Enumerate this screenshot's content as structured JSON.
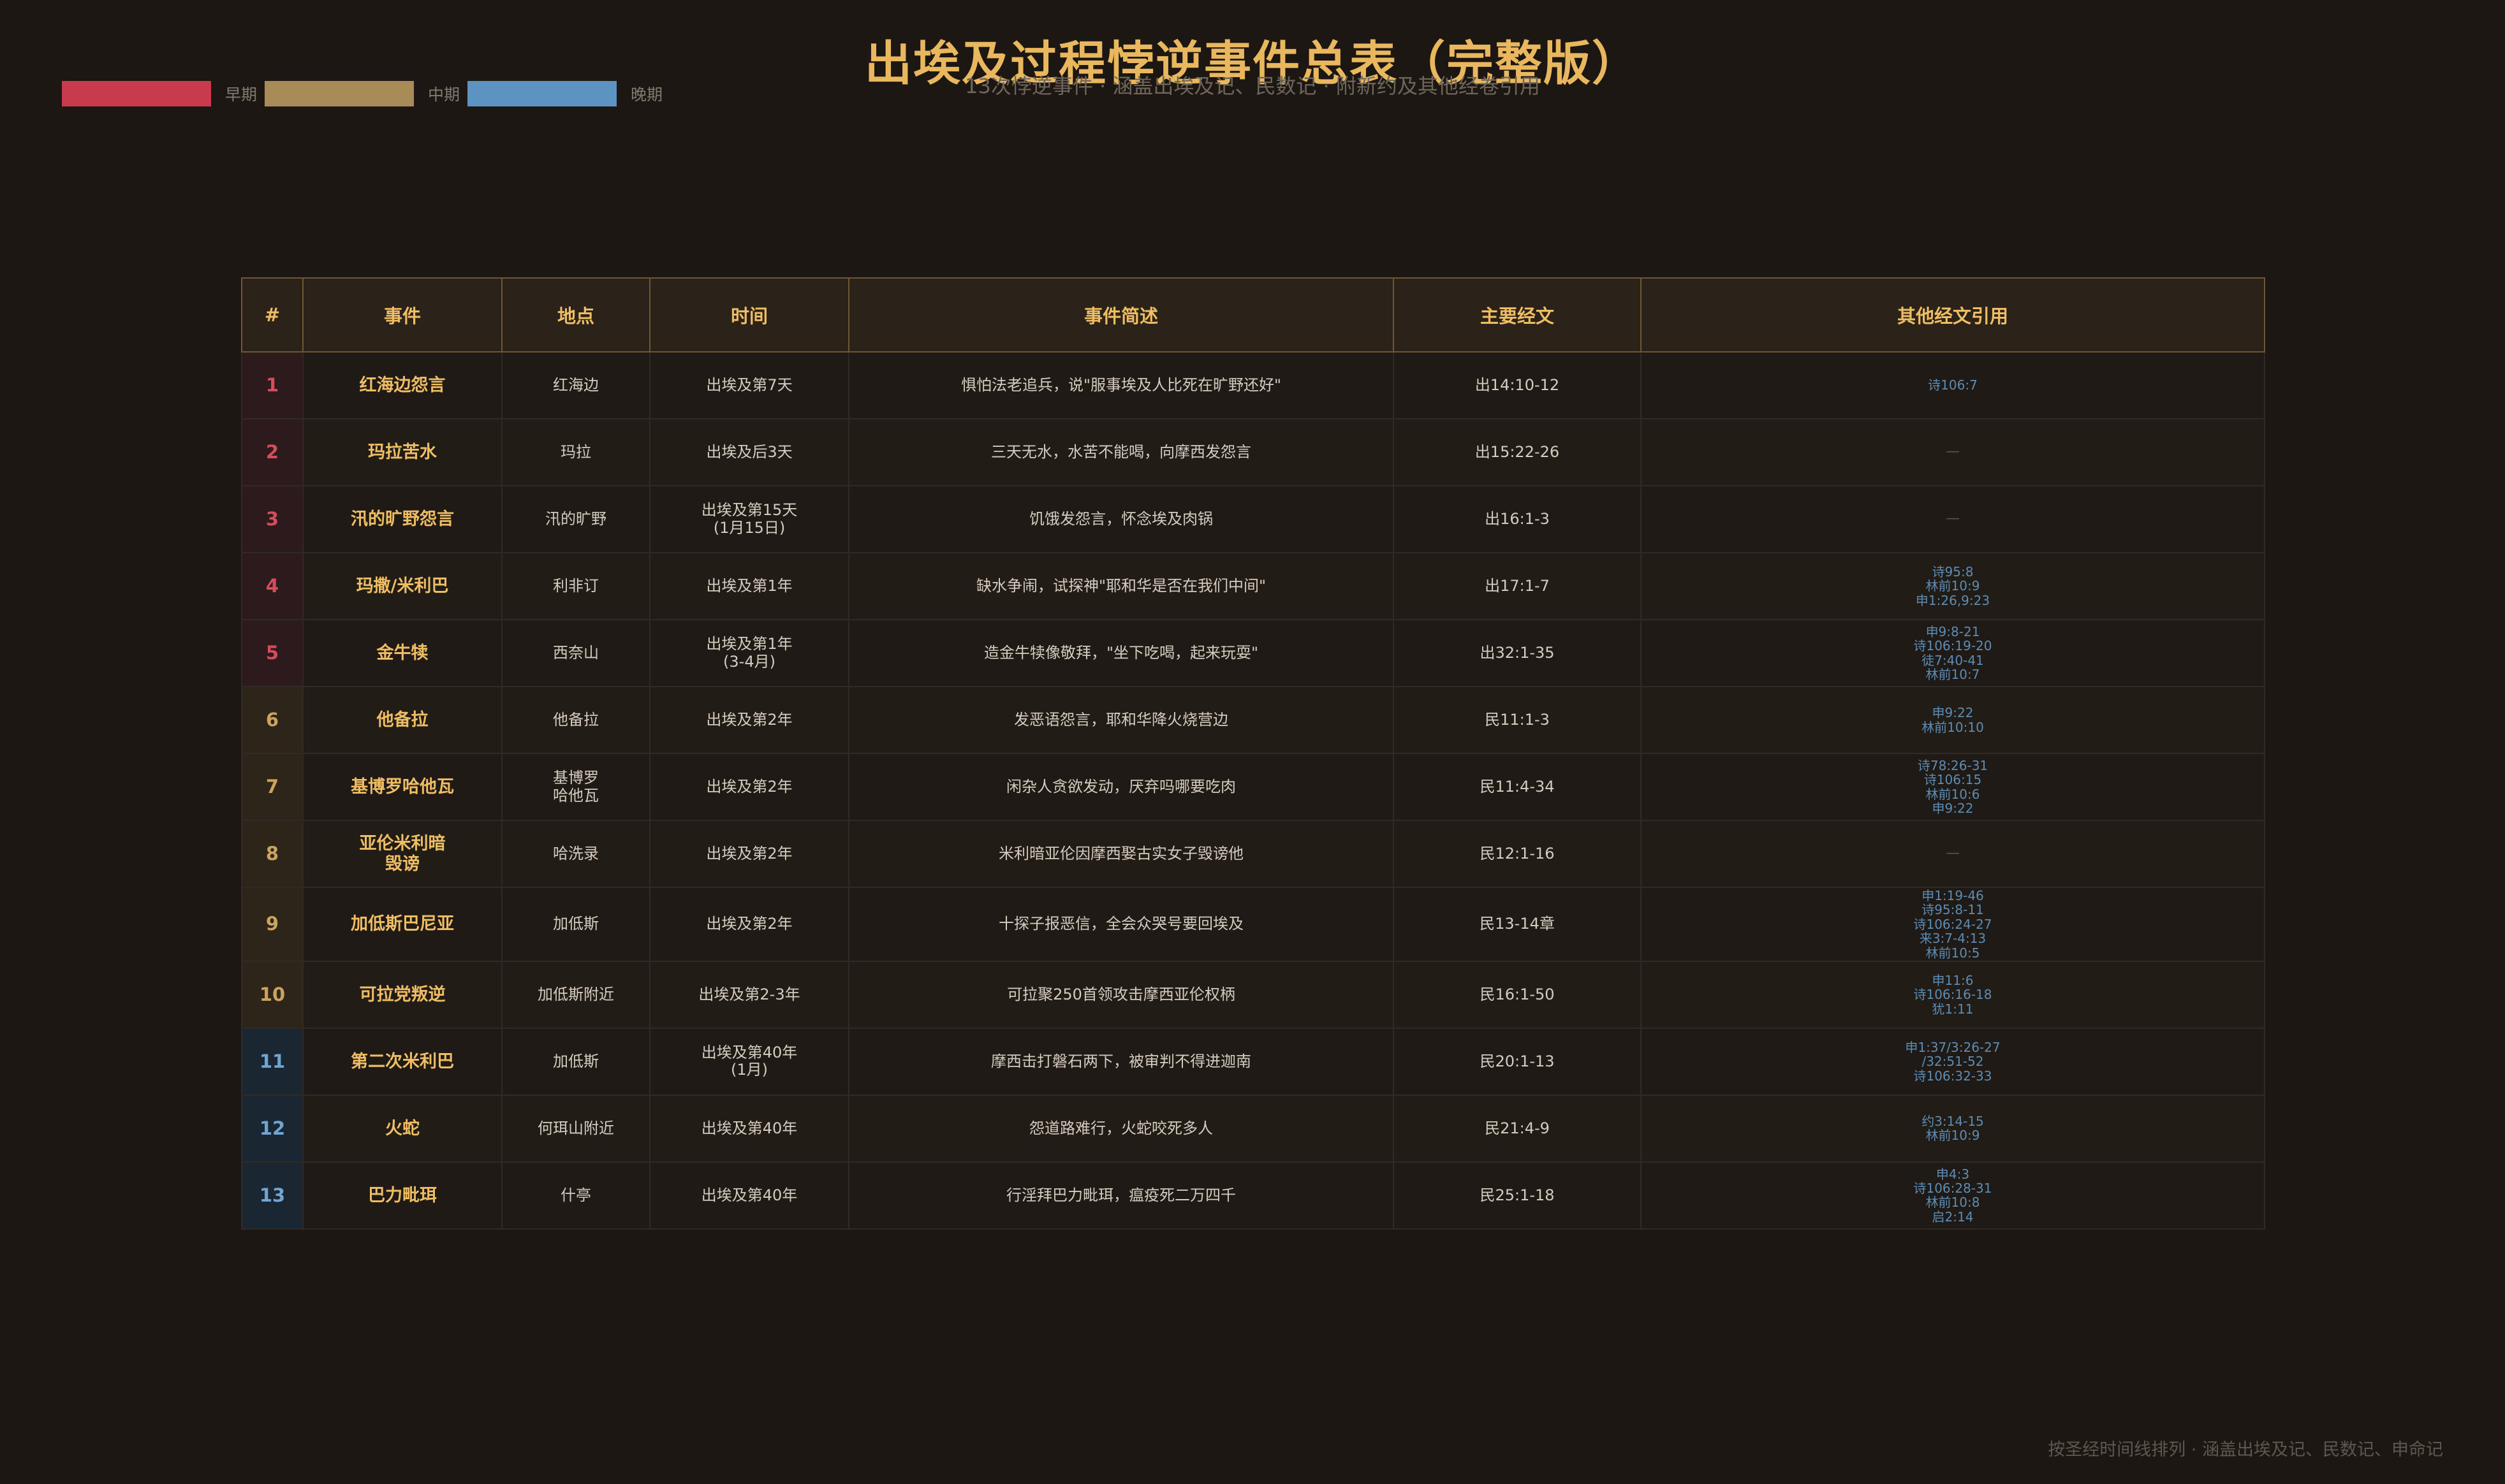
{
  "title": "出埃及过程悖逆事件总表（完整版）",
  "subtitle": "13次悖逆事件 · 涵盖出埃及记、民数记 · 附新约及其他经卷引用",
  "legend": [
    {
      "label": "早期",
      "color": "#c83a4c"
    },
    {
      "label": "中期",
      "color": "#a88c57"
    },
    {
      "label": "晚期",
      "color": "#5d93c0"
    }
  ],
  "colors": {
    "early": "#d44d5c",
    "mid": "#c9a35f",
    "late": "#6fa5d0",
    "accent": "#efbe64"
  },
  "table": {
    "headers": [
      "#",
      "事件",
      "地点",
      "时间",
      "事件简述",
      "主要经文",
      "其他经文引用"
    ],
    "rows": [
      {
        "num": "1",
        "period": "early",
        "event": "红海边怨言",
        "place": "红海边",
        "time": "出埃及第7天",
        "summary": "惧怕法老追兵，说\"服事埃及人比死在旷野还好\"",
        "main": "出14:10-12",
        "refs": [
          "诗106:7"
        ]
      },
      {
        "num": "2",
        "period": "early",
        "event": "玛拉苦水",
        "place": "玛拉",
        "time": "出埃及后3天",
        "summary": "三天无水，水苦不能喝，向摩西发怨言",
        "main": "出15:22-26",
        "refs": [
          "—"
        ]
      },
      {
        "num": "3",
        "period": "early",
        "event": "汛的旷野怨言",
        "place": "汛的旷野",
        "time": "出埃及第15天\n(1月15日)",
        "summary": "饥饿发怨言，怀念埃及肉锅",
        "main": "出16:1-3",
        "refs": [
          "—"
        ]
      },
      {
        "num": "4",
        "period": "early",
        "event": "玛撒/米利巴",
        "place": "利非订",
        "time": "出埃及第1年",
        "summary": "缺水争闹，试探神\"耶和华是否在我们中间\"",
        "main": "出17:1-7",
        "refs": [
          "诗95:8",
          "林前10:9",
          "申1:26,9:23"
        ]
      },
      {
        "num": "5",
        "period": "early",
        "event": "金牛犊",
        "place": "西奈山",
        "time": "出埃及第1年\n(3-4月)",
        "summary": "造金牛犊像敬拜，\"坐下吃喝，起来玩耍\"",
        "main": "出32:1-35",
        "refs": [
          "申9:8-21",
          "诗106:19-20",
          "徒7:40-41",
          "林前10:7"
        ]
      },
      {
        "num": "6",
        "period": "mid",
        "event": "他备拉",
        "place": "他备拉",
        "time": "出埃及第2年",
        "summary": "发恶语怨言，耶和华降火烧营边",
        "main": "民11:1-3",
        "refs": [
          "申9:22",
          "林前10:10"
        ]
      },
      {
        "num": "7",
        "period": "mid",
        "event": "基博罗哈他瓦",
        "place": "基博罗\n哈他瓦",
        "time": "出埃及第2年",
        "summary": "闲杂人贪欲发动，厌弃吗哪要吃肉",
        "main": "民11:4-34",
        "refs": [
          "诗78:26-31",
          "诗106:15",
          "林前10:6",
          "申9:22"
        ]
      },
      {
        "num": "8",
        "period": "mid",
        "event": "亚伦米利暗\n毁谤",
        "place": "哈洗录",
        "time": "出埃及第2年",
        "summary": "米利暗亚伦因摩西娶古实女子毁谤他",
        "main": "民12:1-16",
        "refs": [
          "—"
        ]
      },
      {
        "num": "9",
        "period": "mid",
        "event": "加低斯巴尼亚",
        "place": "加低斯",
        "time": "出埃及第2年",
        "summary": "十探子报恶信，全会众哭号要回埃及",
        "main": "民13-14章",
        "refs": [
          "申1:19-46",
          "诗95:8-11",
          "诗106:24-27",
          "来3:7-4:13",
          "林前10:5"
        ]
      },
      {
        "num": "10",
        "period": "mid",
        "event": "可拉党叛逆",
        "place": "加低斯附近",
        "time": "出埃及第2-3年",
        "summary": "可拉聚250首领攻击摩西亚伦权柄",
        "main": "民16:1-50",
        "refs": [
          "申11:6",
          "诗106:16-18",
          "犹1:11"
        ]
      },
      {
        "num": "11",
        "period": "late",
        "event": "第二次米利巴",
        "place": "加低斯",
        "time": "出埃及第40年\n(1月)",
        "summary": "摩西击打磐石两下，被审判不得进迦南",
        "main": "民20:1-13",
        "refs": [
          "申1:37/3:26-27",
          "/32:51-52",
          "诗106:32-33"
        ]
      },
      {
        "num": "12",
        "period": "late",
        "event": "火蛇",
        "place": "何珥山附近",
        "time": "出埃及第40年",
        "summary": "怨道路难行，火蛇咬死多人",
        "main": "民21:4-9",
        "refs": [
          "约3:14-15",
          "林前10:9"
        ]
      },
      {
        "num": "13",
        "period": "late",
        "event": "巴力毗珥",
        "place": "什亭",
        "time": "出埃及第40年",
        "summary": "行淫拜巴力毗珥，瘟疫死二万四千",
        "main": "民25:1-18",
        "refs": [
          "申4:3",
          "诗106:28-31",
          "林前10:8",
          "启2:14"
        ]
      }
    ]
  },
  "footer": "按圣经时间线排列 · 涵盖出埃及记、民数记、申命记"
}
